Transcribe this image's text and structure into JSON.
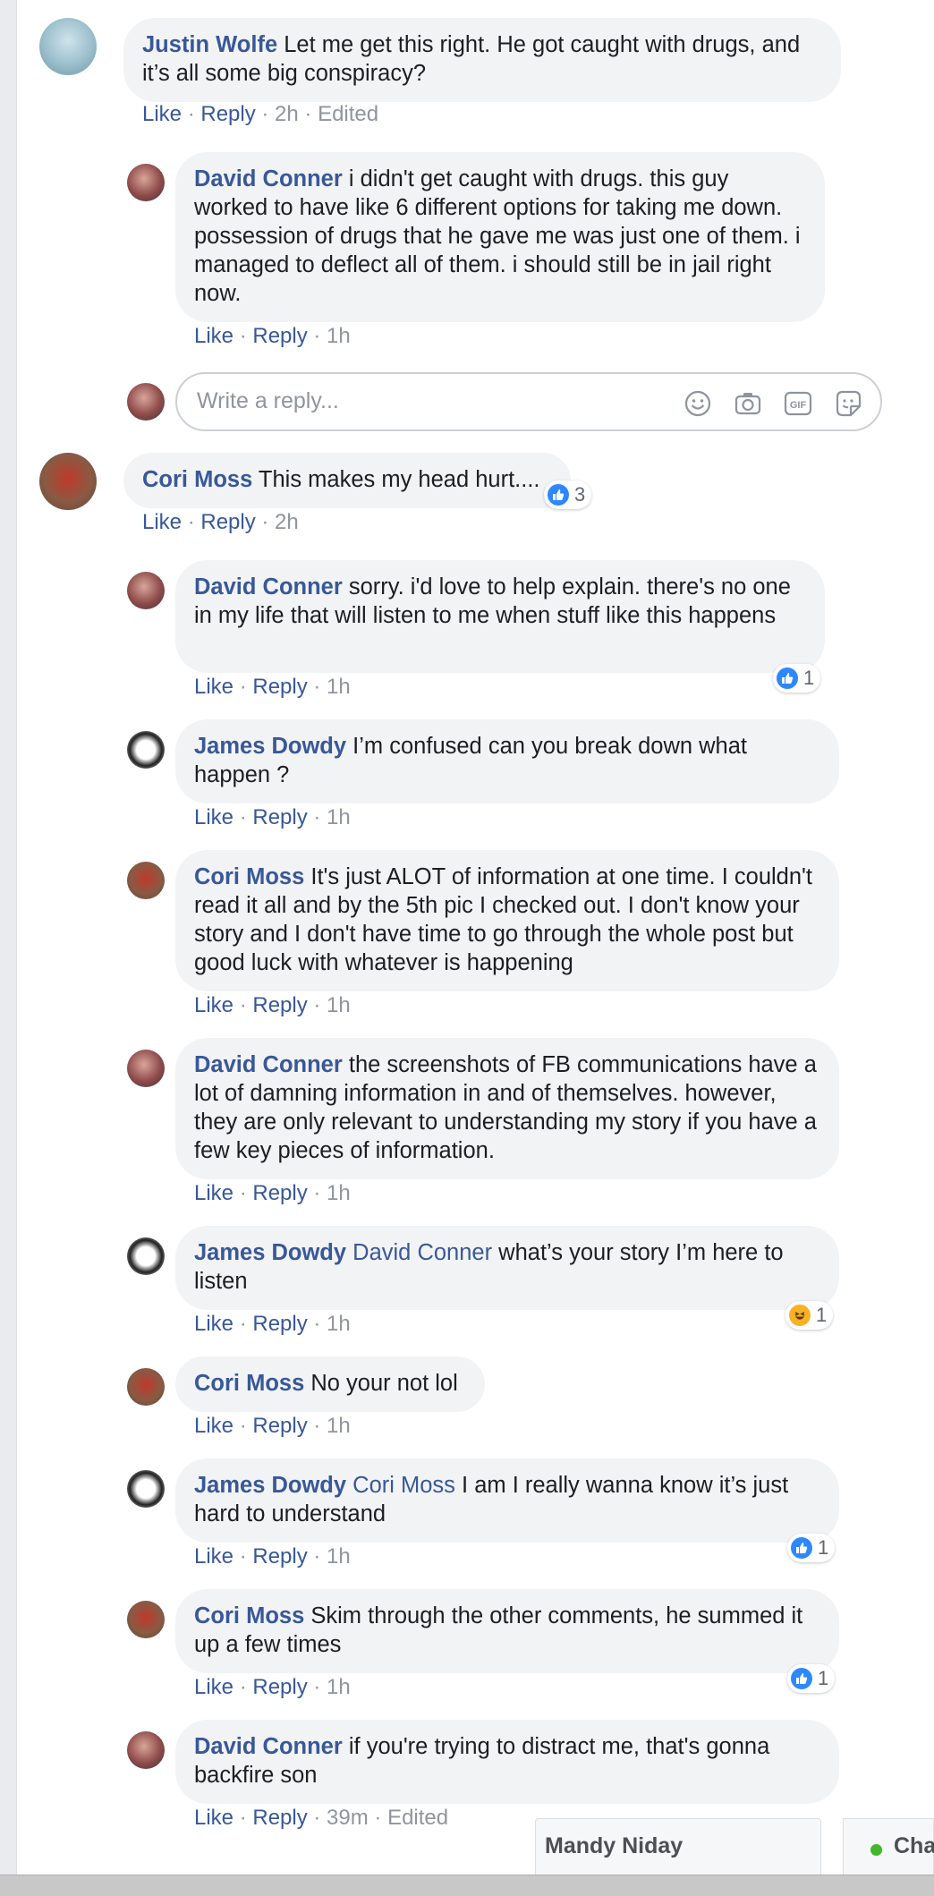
{
  "actions": {
    "like": "Like",
    "reply": "Reply",
    "sep": " · ",
    "edited": "Edited"
  },
  "comments": [
    {
      "author": "Justin Wolfe",
      "text": " Let me get this right. He got caught with drugs, and it’s all some big conspiracy?",
      "time": "2h",
      "edited": true
    },
    {
      "author": "David Conner",
      "text": " i didn't get caught with drugs. this guy worked to have like 6 different options for taking me down. possession of drugs that he gave me was just one of them. i managed to deflect all of them. i should still be in jail right now.",
      "time": "1h"
    },
    {
      "author": "Cori Moss",
      "text": " This makes my head hurt....",
      "time": "2h",
      "reaction_count": "3"
    },
    {
      "author": "David Conner",
      "text": " sorry. i'd love to help explain. there's no one in my life that will listen to me when stuff like this happens",
      "time": "1h",
      "reaction_count": "1"
    },
    {
      "author": "James Dowdy",
      "text": " I’m confused can you break down what happen ?",
      "time": "1h"
    },
    {
      "author": "Cori Moss",
      "text": " It's just ALOT of information at one time. I couldn't read it all and by the 5th pic I checked out. I don't know your story and I don't have time to go through the whole post but good luck with whatever is happening",
      "time": "1h"
    },
    {
      "author": "David Conner",
      "text": " the screenshots of FB communications have a lot of damning information in and of themselves. however, they are only relevant to understanding my story if you have a few key pieces of information.",
      "time": "1h"
    },
    {
      "author": "James Dowdy",
      "mention": "David Conner",
      "text": " what’s your story I’m here to listen",
      "time": "1h",
      "reaction_count": "1"
    },
    {
      "author": "Cori Moss",
      "text": " No your not lol",
      "time": "1h"
    },
    {
      "author": "James Dowdy",
      "mention": "Cori Moss",
      "text": " I am I really wanna know it’s just hard to understand",
      "time": "1h",
      "reaction_count": "1"
    },
    {
      "author": "Cori Moss",
      "text": " Skim through the other comments, he summed it up a few times",
      "time": "1h",
      "reaction_count": "1"
    },
    {
      "author": "David Conner",
      "text": " if you're trying to distract me, that's gonna backfire son",
      "time": "39m",
      "edited": true
    }
  ],
  "reply_box": {
    "placeholder": "Write a reply...",
    "icons": [
      "emoji-icon",
      "camera-icon",
      "gif-icon",
      "sticker-icon"
    ],
    "gif_label": "GIF"
  },
  "chat": {
    "tab1_name": "Mandy Niday",
    "tab2_name": "Cha",
    "online_color": "#42b72a"
  },
  "colors": {
    "author": "#385898",
    "bubble": "#f2f3f5",
    "meta": "#90949c",
    "like_blue": "#2d88ff"
  }
}
